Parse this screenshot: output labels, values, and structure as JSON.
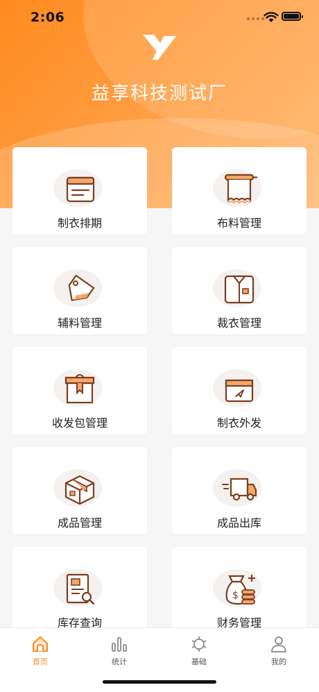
{
  "status": {
    "time": "2:06"
  },
  "brand": {
    "name": "益享科技测试厂"
  },
  "colors": {
    "accent": "#f08b2a",
    "header": "#ff9a3c"
  },
  "menu": [
    {
      "label": "制衣排期",
      "icon": "calendar-icon"
    },
    {
      "label": "布料管理",
      "icon": "fabric-roll-icon"
    },
    {
      "label": "辅料管理",
      "icon": "tag-icon"
    },
    {
      "label": "裁衣管理",
      "icon": "shirt-icon"
    },
    {
      "label": "收发包管理",
      "icon": "package-icon"
    },
    {
      "label": "制衣外发",
      "icon": "dispatch-box-icon"
    },
    {
      "label": "成品管理",
      "icon": "product-box-icon"
    },
    {
      "label": "成品出库",
      "icon": "delivery-truck-icon"
    },
    {
      "label": "库存查询",
      "icon": "inventory-search-icon"
    },
    {
      "label": "财务管理",
      "icon": "money-bag-icon"
    }
  ],
  "tabs": [
    {
      "label": "首页",
      "icon": "home-icon",
      "active": true
    },
    {
      "label": "统计",
      "icon": "bar-chart-icon",
      "active": false
    },
    {
      "label": "基础",
      "icon": "settings-hex-icon",
      "active": false
    },
    {
      "label": "我的",
      "icon": "user-icon",
      "active": false
    }
  ]
}
